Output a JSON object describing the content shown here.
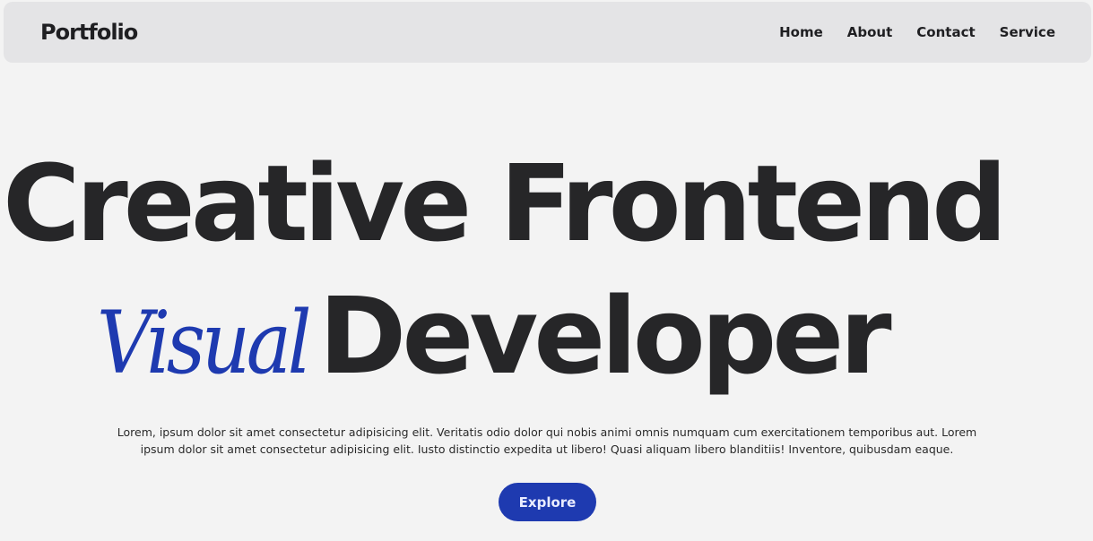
{
  "nav": {
    "brand": "Portfolio",
    "links": [
      {
        "label": "Home"
      },
      {
        "label": "About"
      },
      {
        "label": "Contact"
      },
      {
        "label": "Service"
      }
    ]
  },
  "hero": {
    "line1": "Creative Frontend",
    "accent": "Visual",
    "line2": "Developer",
    "description": "Lorem, ipsum dolor sit amet consectetur adipisicing elit. Veritatis odio dolor qui nobis animi omnis numquam cum exercitationem temporibus aut. Lorem ipsum dolor sit amet consectetur adipisicing elit. Iusto distinctio expedita ut libero! Quasi aliquam libero blanditiis! Inventore, quibusdam eaque.",
    "cta": "Explore"
  },
  "colors": {
    "background": "#f3f3f3",
    "navbar": "#e4e4e6",
    "text": "#262628",
    "accent": "#1e3ab0"
  }
}
